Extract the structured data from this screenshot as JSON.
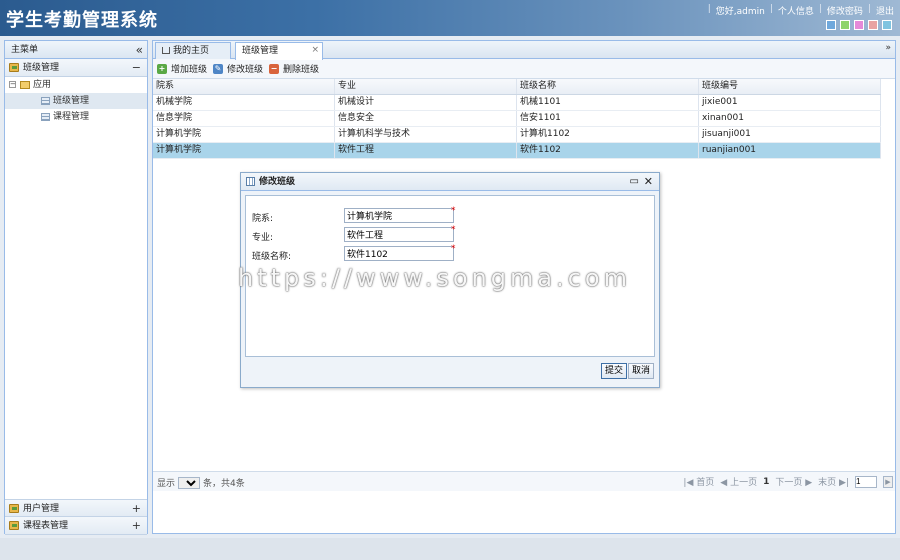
{
  "app": {
    "title": "学生考勤管理系统"
  },
  "toplinks": [
    "您好,admin",
    "个人信息",
    "修改密码",
    "退出"
  ],
  "themes": [
    "#6fa8dc",
    "#8fd46b",
    "#e58ad8",
    "#e8a2a2",
    "#80c4e0"
  ],
  "sidebar": {
    "header": "主菜单",
    "sections": [
      {
        "label": "班级管理",
        "toggle": "−"
      },
      {
        "label": "用户管理",
        "toggle": "+"
      },
      {
        "label": "课程表管理",
        "toggle": "+"
      }
    ],
    "tree": {
      "root": "应用",
      "items": [
        "班级管理",
        "课程管理"
      ]
    }
  },
  "tabs": [
    {
      "label": "我的主页"
    },
    {
      "label": "班级管理"
    }
  ],
  "toolbar": {
    "add": "增加班级",
    "edit": "修改班级",
    "delete": "删除班级"
  },
  "grid": {
    "columns": [
      "院系",
      "专业",
      "班级名称",
      "班级编号"
    ],
    "rows": [
      [
        "机械学院",
        "机械设计",
        "机械1101",
        "jixie001"
      ],
      [
        "信息学院",
        "信息安全",
        "信安1101",
        "xinan001"
      ],
      [
        "计算机学院",
        "计算机科学与技术",
        "计算机1102",
        "jisuanji001"
      ],
      [
        "计算机学院",
        "软件工程",
        "软件1102",
        "ruanjian001"
      ]
    ]
  },
  "pager": {
    "show_label": "显示",
    "page_size": "5",
    "summary": "条，共4条",
    "first": "首页",
    "prev": "上一页",
    "current": "1",
    "next": "下一页",
    "last": "末页",
    "goto_value": "1"
  },
  "dialog": {
    "title": "修改班级",
    "fields": [
      {
        "label": "院系:",
        "value": "计算机学院"
      },
      {
        "label": "专业:",
        "value": "软件工程"
      },
      {
        "label": "班级名称:",
        "value": "软件1102"
      }
    ],
    "submit": "提交",
    "cancel": "取消"
  },
  "watermark": "https://www.songma.com"
}
